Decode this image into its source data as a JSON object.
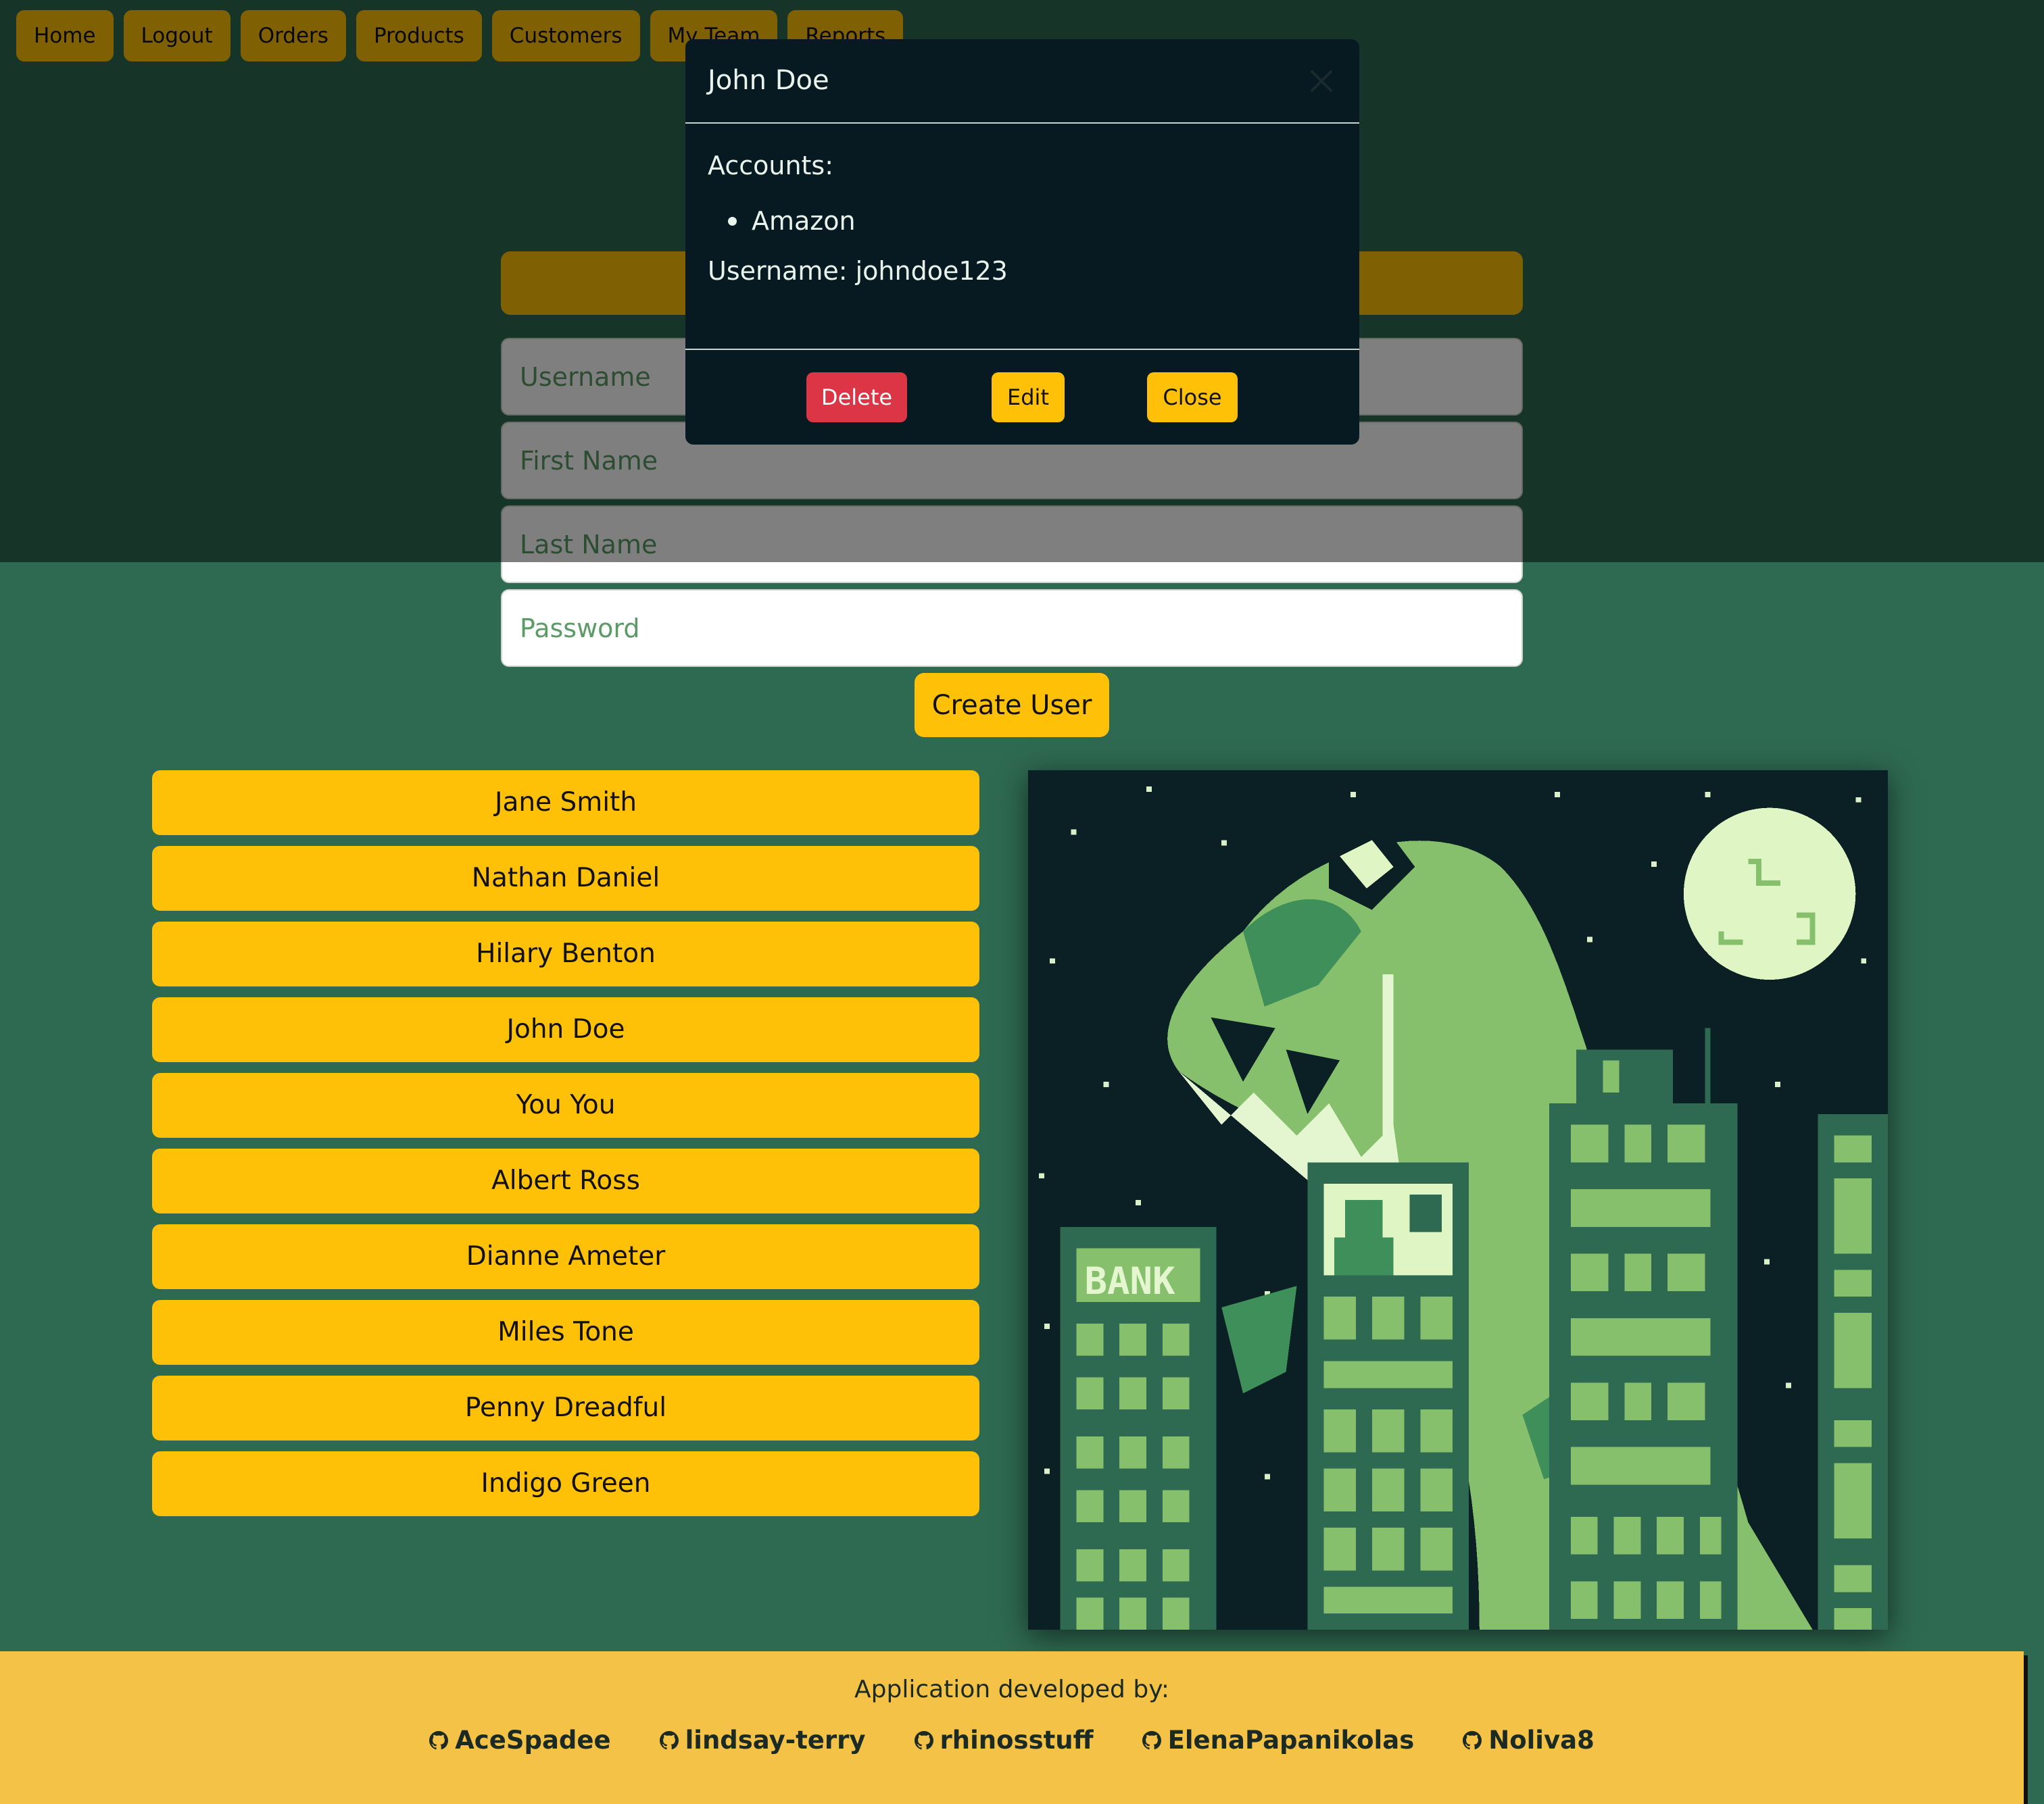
{
  "nav": {
    "items": [
      "Home",
      "Logout",
      "Orders",
      "Products",
      "Customers",
      "My Team",
      "Reports"
    ]
  },
  "form": {
    "username_placeholder": "Username",
    "firstname_placeholder": "First Name",
    "lastname_placeholder": "Last Name",
    "password_placeholder": "Password",
    "create_label": "Create User"
  },
  "users": [
    "Jane Smith",
    "Nathan Daniel",
    "Hilary Benton",
    "John Doe",
    "You You",
    "Albert Ross",
    "Dianne Ameter",
    "Miles Tone",
    "Penny Dreadful",
    "Indigo Green"
  ],
  "artwork": {
    "sign_text": "BANK"
  },
  "footer": {
    "title": "Application developed by:",
    "developers": [
      "AceSpadee",
      "lindsay-terry",
      "rhinosstuff",
      "ElenaPapanikolas",
      "Noliva8"
    ]
  },
  "modal": {
    "title": "John Doe",
    "accounts_label": "Accounts:",
    "accounts": [
      "Amazon"
    ],
    "username_line": "Username: johndoe123",
    "delete_label": "Delete",
    "edit_label": "Edit",
    "close_label": "Close"
  },
  "colors": {
    "page_bg": "#2e6951",
    "accent": "#ffc107",
    "danger": "#dc3545",
    "modal_bg": "#071a22",
    "footer_bg": "#f4c246"
  }
}
